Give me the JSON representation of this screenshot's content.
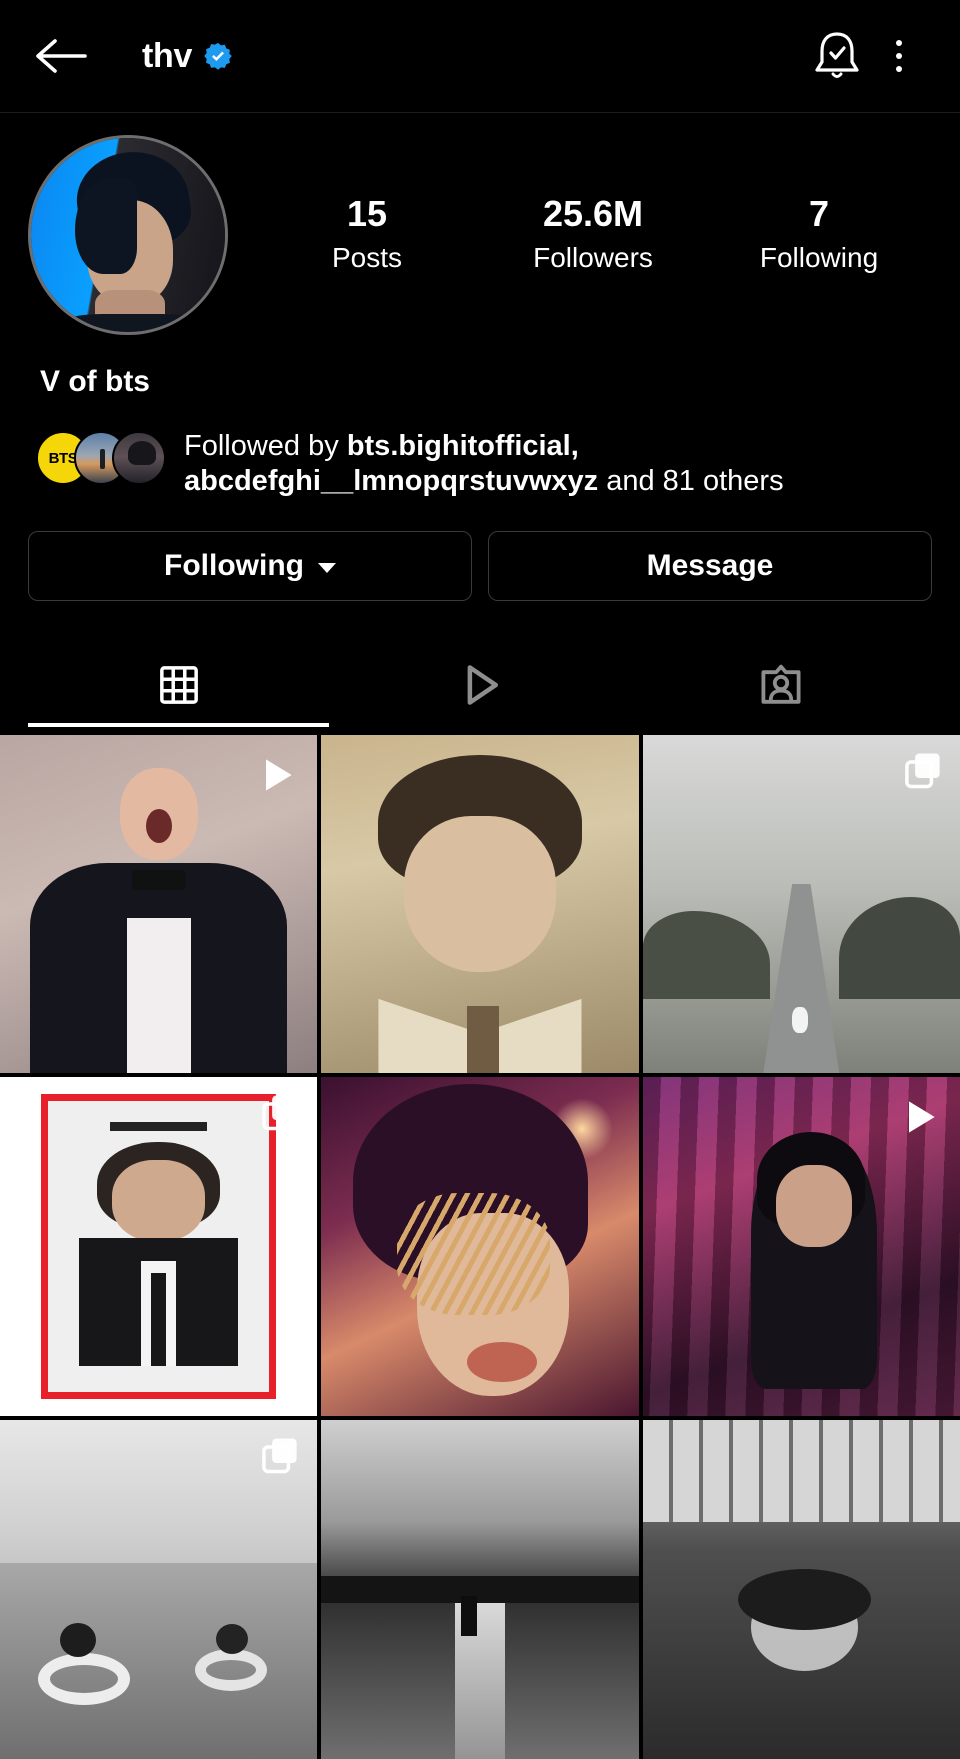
{
  "topbar": {
    "back_icon": "back-arrow-icon",
    "username": "thv",
    "verified_icon": "verified-badge-icon",
    "verified_color": "#1d9bf0",
    "notify_icon": "notification-bell-check-icon",
    "more_icon": "more-options-icon"
  },
  "profile": {
    "avatar_name": "profile-avatar",
    "bio": "V of bts",
    "stats": [
      {
        "num": "15",
        "label": "Posts"
      },
      {
        "num": "25.6M",
        "label": "Followers"
      },
      {
        "num": "7",
        "label": "Following"
      }
    ],
    "followed_by": {
      "prefix": "Followed by ",
      "name1": "bts.bighitofficial,",
      "name2": "abcdefghi__lmnopqrstuvwxyz",
      "suffix": " and 81 others",
      "facepile": [
        "bts-avatar",
        "follower-avatar-2",
        "follower-avatar-3"
      ],
      "facepile_label_1": "BTS"
    },
    "buttons": {
      "following_label": "Following",
      "message_label": "Message"
    }
  },
  "tabs": [
    {
      "name": "grid",
      "icon": "grid-icon",
      "active": true
    },
    {
      "name": "reels",
      "icon": "reels-play-icon",
      "active": false
    },
    {
      "name": "tagged",
      "icon": "tagged-person-icon",
      "active": false
    }
  ],
  "grid": {
    "posts": [
      {
        "id": "post-1",
        "art": "a1",
        "overlay": "video-play-icon"
      },
      {
        "id": "post-2",
        "art": "a2",
        "overlay": ""
      },
      {
        "id": "post-3",
        "art": "a3",
        "overlay": "carousel-icon"
      },
      {
        "id": "post-4",
        "art": "a4",
        "overlay": "carousel-icon"
      },
      {
        "id": "post-5",
        "art": "a5",
        "overlay": ""
      },
      {
        "id": "post-6",
        "art": "a6",
        "overlay": "video-play-icon"
      },
      {
        "id": "post-7",
        "art": "a7",
        "overlay": "carousel-icon"
      },
      {
        "id": "post-8",
        "art": "a8",
        "overlay": ""
      },
      {
        "id": "post-9",
        "art": "a9",
        "overlay": ""
      }
    ]
  },
  "colors": {
    "background": "#000000",
    "text": "#ffffff",
    "border": "#3a3a3a",
    "verified_blue": "#1d9bf0",
    "inactive_tab": "#8e8e8e"
  }
}
